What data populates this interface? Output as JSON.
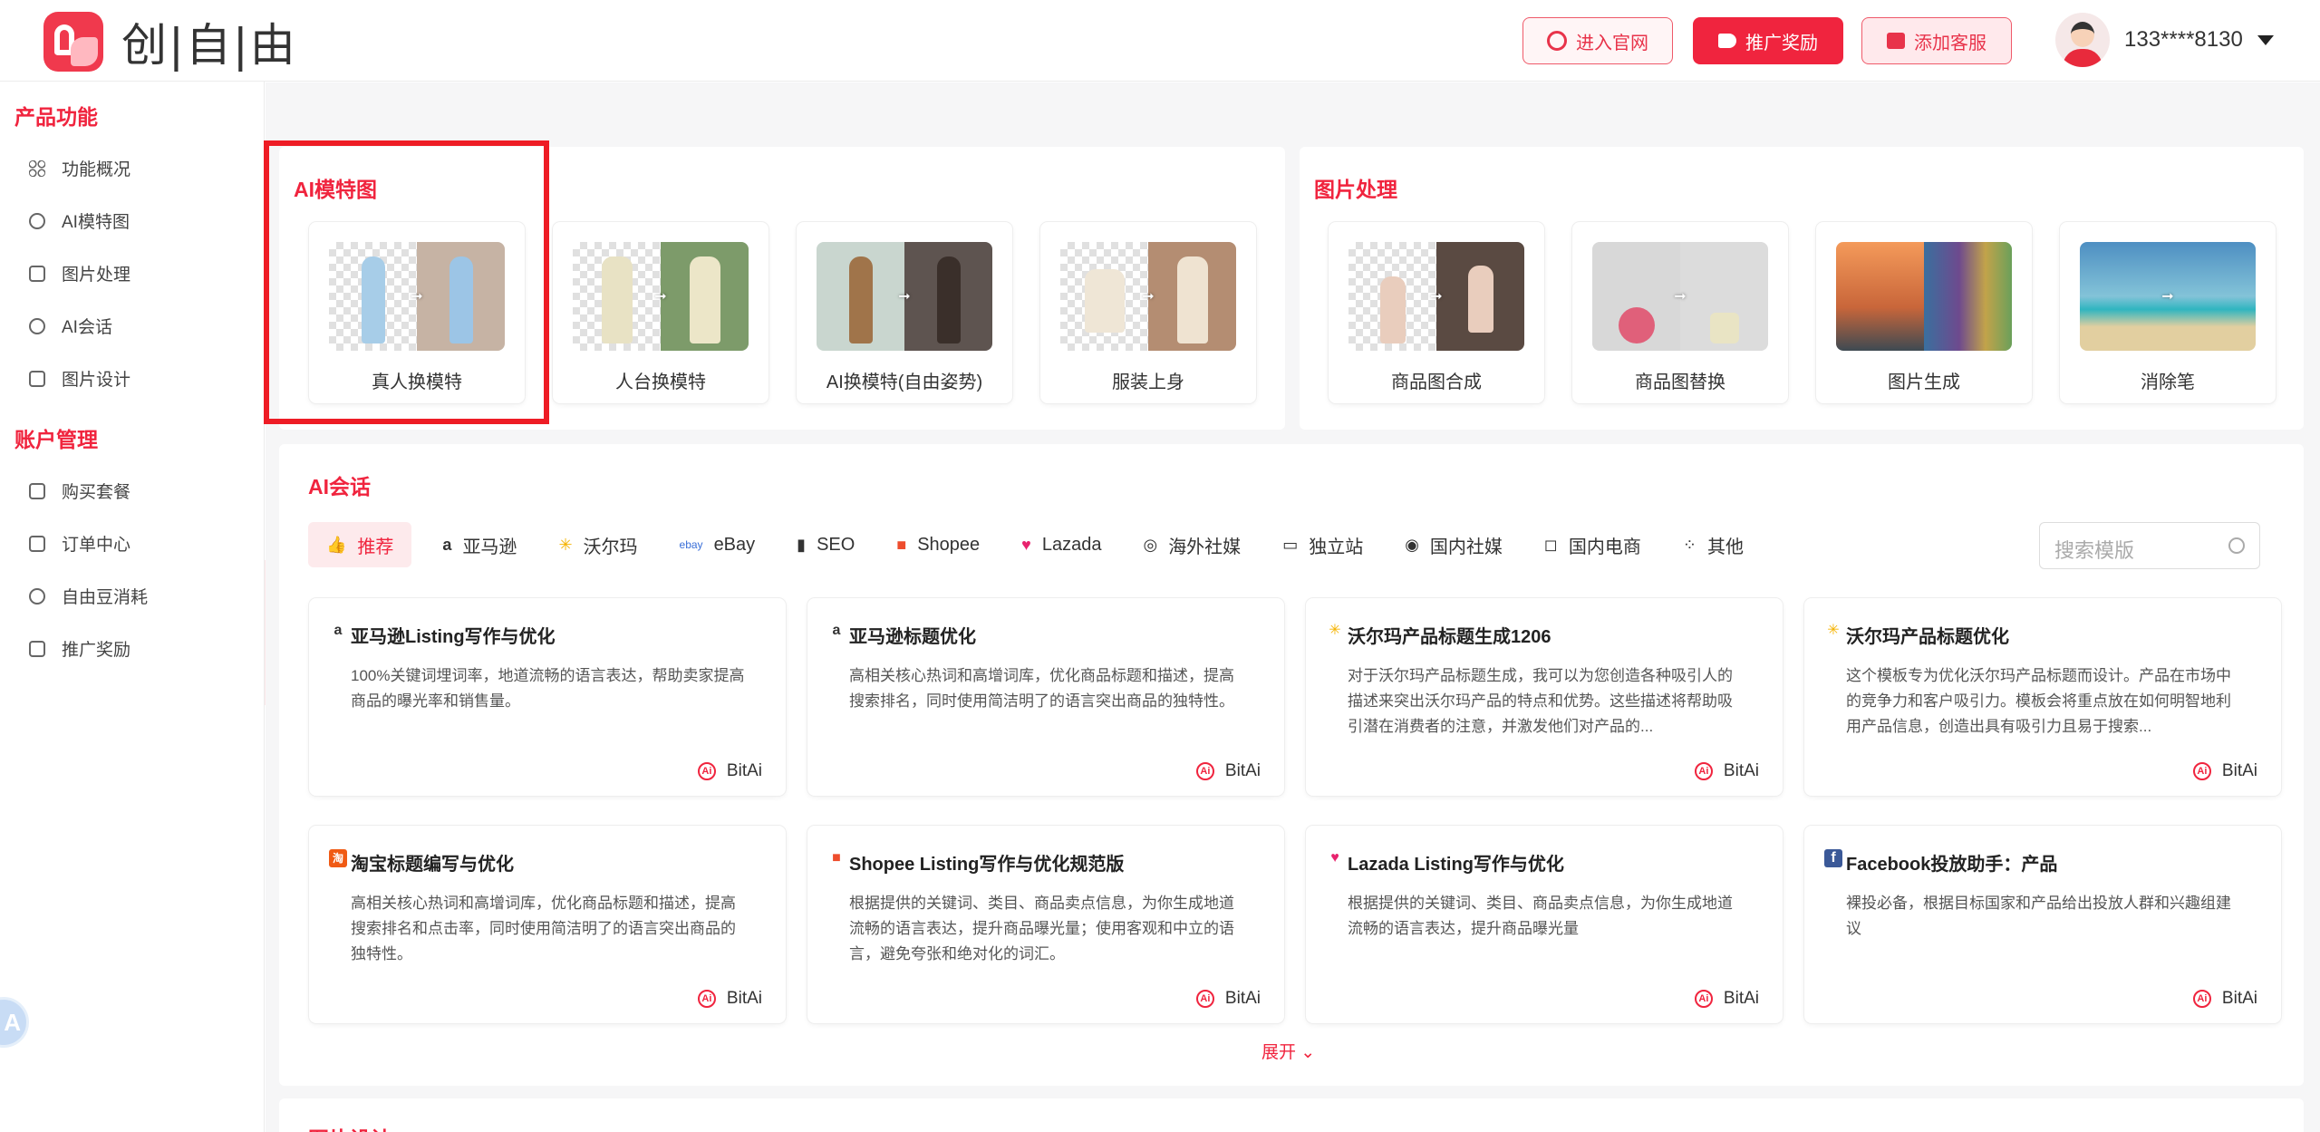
{
  "brand": {
    "logo_text": "创|自|由"
  },
  "header": {
    "buttons": {
      "site": "进入官网",
      "promo": "推广奖励",
      "cs": "添加客服"
    },
    "user_phone": "133****8130"
  },
  "sidebar": {
    "section_product": "产品功能",
    "product_items": [
      {
        "label": "功能概况",
        "icon": "grid-icon"
      },
      {
        "label": "AI模特图",
        "icon": "model-icon"
      },
      {
        "label": "图片处理",
        "icon": "image-icon"
      },
      {
        "label": "AI会话",
        "icon": "chat-icon"
      },
      {
        "label": "图片设计",
        "icon": "design-icon"
      }
    ],
    "section_account": "账户管理",
    "account_items": [
      {
        "label": "购买套餐",
        "icon": "cart-icon"
      },
      {
        "label": "订单中心",
        "icon": "order-icon"
      },
      {
        "label": "自由豆消耗",
        "icon": "coin-icon"
      },
      {
        "label": "推广奖励",
        "icon": "megaphone-icon"
      }
    ]
  },
  "ai_model": {
    "title": "AI模特图",
    "cards": [
      {
        "label": "真人换模特"
      },
      {
        "label": "人台换模特"
      },
      {
        "label": "AI换模特(自由姿势)"
      },
      {
        "label": "服装上身"
      }
    ]
  },
  "image_proc": {
    "title": "图片处理",
    "cards": [
      {
        "label": "商品图合成"
      },
      {
        "label": "商品图替换"
      },
      {
        "label": "图片生成"
      },
      {
        "label": "消除笔"
      }
    ]
  },
  "ai_chat": {
    "title": "AI会话",
    "tabs": [
      {
        "label": "推荐",
        "icon": "thumbs-up-icon"
      },
      {
        "label": "亚马逊",
        "icon": "amazon-icon"
      },
      {
        "label": "沃尔玛",
        "icon": "walmart-icon"
      },
      {
        "label": "eBay",
        "icon": "ebay-icon"
      },
      {
        "label": "SEO",
        "icon": "bar-chart-icon"
      },
      {
        "label": "Shopee",
        "icon": "shopee-icon"
      },
      {
        "label": "Lazada",
        "icon": "lazada-icon"
      },
      {
        "label": "海外社媒",
        "icon": "globe-icon"
      },
      {
        "label": "独立站",
        "icon": "store-icon"
      },
      {
        "label": "国内社媒",
        "icon": "social-icon"
      },
      {
        "label": "国内电商",
        "icon": "bag-icon"
      },
      {
        "label": "其他",
        "icon": "apps-icon"
      }
    ],
    "search_placeholder": "搜索模版",
    "templates": [
      {
        "title": "亚马逊Listing写作与优化",
        "desc": "100%关键词埋词率，地道流畅的语言表达，帮助卖家提高商品的曝光率和销售量。",
        "brand": "BitAi",
        "icon": "amazon-icon"
      },
      {
        "title": "亚马逊标题优化",
        "desc": "高相关核心热词和高增词库，优化商品标题和描述，提高搜索排名，同时使用简洁明了的语言突出商品的独特性。",
        "brand": "BitAi",
        "icon": "amazon-icon"
      },
      {
        "title": "沃尔玛产品标题生成1206",
        "desc": "对于沃尔玛产品标题生成，我可以为您创造各种吸引人的描述来突出沃尔玛产品的特点和优势。这些描述将帮助吸引潜在消费者的注意，并激发他们对产品的...",
        "brand": "BitAi",
        "icon": "walmart-icon"
      },
      {
        "title": "沃尔玛产品标题优化",
        "desc": "这个模板专为优化沃尔玛产品标题而设计。产品在市场中的竞争力和客户吸引力。模板会将重点放在如何明智地利用产品信息，创造出具有吸引力且易于搜索...",
        "brand": "BitAi",
        "icon": "walmart-icon"
      },
      {
        "title": "淘宝标题编写与优化",
        "desc": "高相关核心热词和高增词库，优化商品标题和描述，提高搜索排名和点击率，同时使用简洁明了的语言突出商品的独特性。",
        "brand": "BitAi",
        "icon": "taobao-icon"
      },
      {
        "title": "Shopee Listing写作与优化规范版",
        "desc": "根据提供的关键词、类目、商品卖点信息，为你生成地道流畅的语言表达，提升商品曝光量；使用客观和中立的语言，避免夸张和绝对化的词汇。",
        "brand": "BitAi",
        "icon": "shopee-icon"
      },
      {
        "title": "Lazada Listing写作与优化",
        "desc": "根据提供的关键词、类目、商品卖点信息，为你生成地道流畅的语言表达，提升商品曝光量",
        "brand": "BitAi",
        "icon": "lazada-icon"
      },
      {
        "title": "Facebook投放助手：产品",
        "desc": "裸投必备，根据目标国家和产品给出投放人群和兴趣组建议",
        "brand": "BitAi",
        "icon": "facebook-icon"
      }
    ],
    "expand_label": "展开"
  },
  "next_section": {
    "title": "图片设计"
  },
  "colors": {
    "accent": "#f0243e",
    "highlight_box": "#ee1c25"
  }
}
